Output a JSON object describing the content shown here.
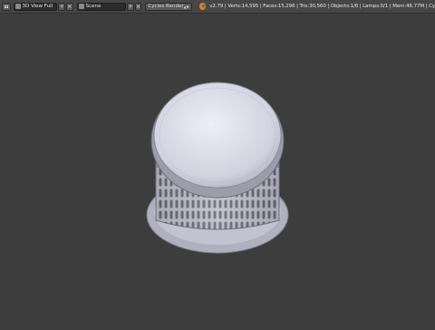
{
  "header": {
    "editor_type_icon": "3d-view-icon",
    "screen_layout": "3D View Full",
    "scene": "Scene",
    "render_engine": "Cycles Render",
    "stats": "v2.79 | Verts:14,595 | Faces:15,296 | Tris:30,560 | Objects:1/6 | Lamps:0/1 | Mem:46.77M | Cy"
  },
  "colors": {
    "viewport_bg": "#3d3d3d",
    "header_bg": "#464646",
    "object_base": "#b9b9c8",
    "object_highlight": "#ededf8"
  },
  "viewport": {
    "object": "cylindrical mesh basket with lid (top view)"
  }
}
